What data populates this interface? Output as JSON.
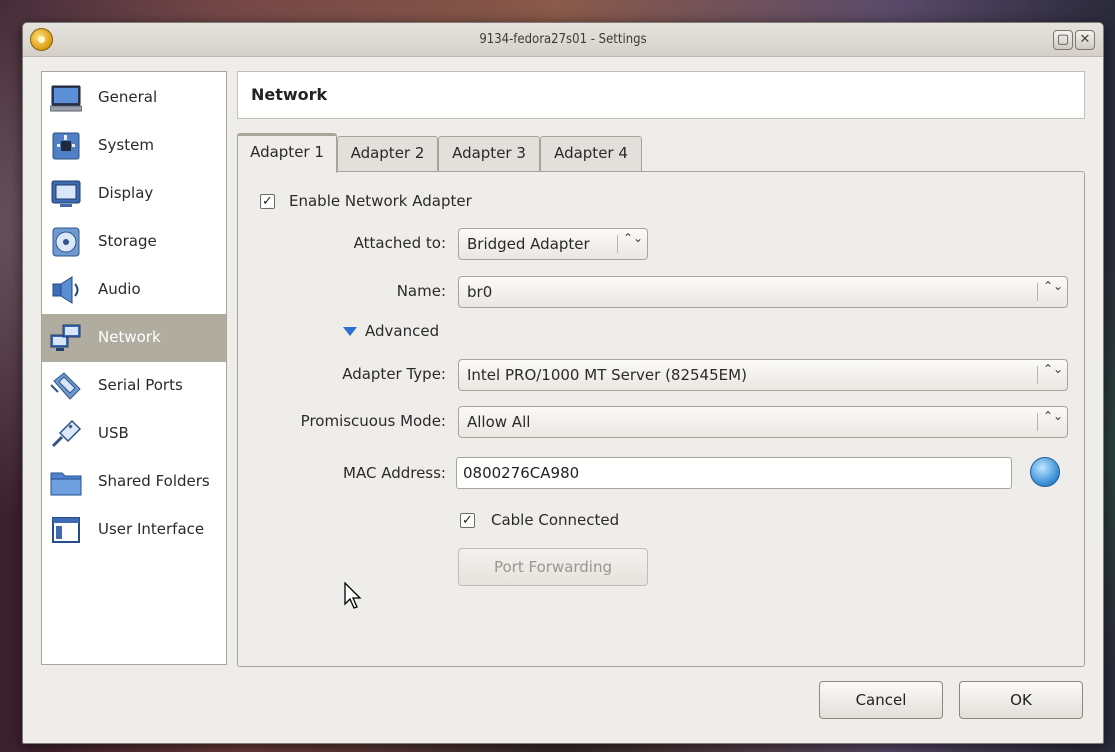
{
  "window": {
    "title": "9134-fedora27s01 - Settings",
    "maximize_glyph": "▢",
    "close_glyph": "✕"
  },
  "sidebar": {
    "items": [
      {
        "label": "General",
        "icon": "general-icon"
      },
      {
        "label": "System",
        "icon": "system-icon"
      },
      {
        "label": "Display",
        "icon": "display-icon"
      },
      {
        "label": "Storage",
        "icon": "storage-icon"
      },
      {
        "label": "Audio",
        "icon": "audio-icon"
      },
      {
        "label": "Network",
        "icon": "network-icon",
        "selected": true
      },
      {
        "label": "Serial Ports",
        "icon": "serial-ports-icon"
      },
      {
        "label": "USB",
        "icon": "usb-icon"
      },
      {
        "label": "Shared Folders",
        "icon": "shared-folders-icon"
      },
      {
        "label": "User Interface",
        "icon": "user-interface-icon"
      }
    ]
  },
  "header": {
    "title": "Network"
  },
  "tabs": [
    {
      "label": "Adapter 1",
      "active": true
    },
    {
      "label": "Adapter 2"
    },
    {
      "label": "Adapter 3"
    },
    {
      "label": "Adapter 4"
    }
  ],
  "adapter": {
    "enable_label": "Enable Network Adapter",
    "enable_checked": "✓",
    "attached_label": "Attached to:",
    "attached_value": "Bridged Adapter",
    "name_label": "Name:",
    "name_value": "br0",
    "advanced_label": "Advanced",
    "adapter_type_label": "Adapter Type:",
    "adapter_type_value": "Intel PRO/1000 MT Server (82545EM)",
    "promiscuous_label": "Promiscuous Mode:",
    "promiscuous_value": "Allow All",
    "mac_label": "MAC Address:",
    "mac_value": "0800276CA980",
    "cable_label": "Cable Connected",
    "cable_checked": "✓",
    "port_forwarding_label": "Port Forwarding",
    "combo_arrows": "⌃⌄"
  },
  "footer": {
    "cancel_label": "Cancel",
    "ok_label": "OK"
  },
  "colors": {
    "selected_bg": "#b0ac9f",
    "accent": "#2e6fd1"
  }
}
